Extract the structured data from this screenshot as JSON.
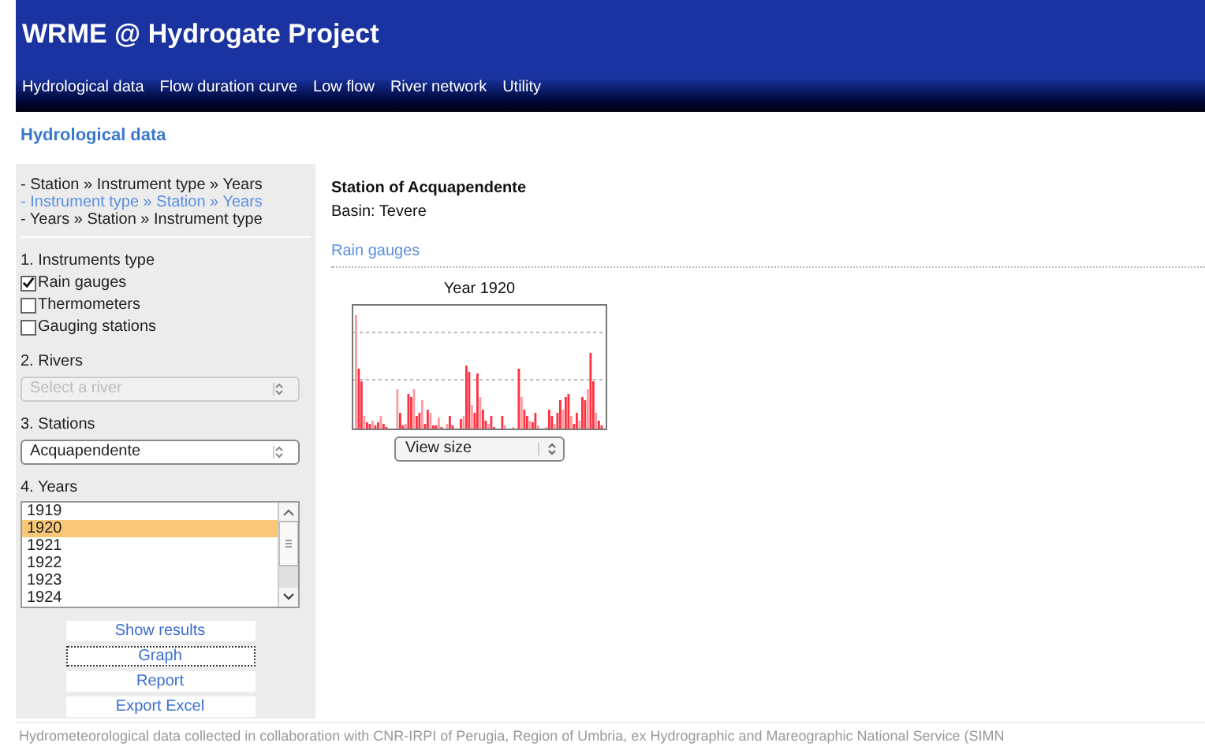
{
  "header": {
    "title": "WRME @ Hydrogate Project"
  },
  "nav": [
    {
      "label": "Hydrological data"
    },
    {
      "label": "Flow duration curve"
    },
    {
      "label": "Low flow"
    },
    {
      "label": "River network"
    },
    {
      "label": "Utility"
    }
  ],
  "page_title": "Hydrological data",
  "sidebar": {
    "paths": [
      {
        "label": "- Station » Instrument type » Years",
        "selected": false
      },
      {
        "label": "- Instrument type » Station » Years",
        "selected": true
      },
      {
        "label": "- Years » Station » Instrument type",
        "selected": false
      }
    ],
    "instruments_heading": "1. Instruments type",
    "instruments": [
      {
        "label": "Rain gauges",
        "checked": true
      },
      {
        "label": "Thermometers",
        "checked": false
      },
      {
        "label": "Gauging stations",
        "checked": false
      }
    ],
    "rivers_heading": "2. Rivers",
    "rivers_select": {
      "placeholder": "Select a river",
      "disabled": true
    },
    "stations_heading": "3. Stations",
    "stations_select": {
      "value": "Acquapendente",
      "disabled": false
    },
    "years_heading": "4. Years",
    "years": [
      {
        "label": "1919",
        "selected": false
      },
      {
        "label": "1920",
        "selected": true
      },
      {
        "label": "1921",
        "selected": false
      },
      {
        "label": "1922",
        "selected": false
      },
      {
        "label": "1923",
        "selected": false
      },
      {
        "label": "1924",
        "selected": false
      }
    ],
    "buttons": [
      {
        "label": "Show results",
        "focused": false
      },
      {
        "label": "Graph",
        "focused": true
      },
      {
        "label": "Report",
        "focused": false
      },
      {
        "label": "Export Excel",
        "focused": false
      }
    ]
  },
  "main": {
    "station": "Station of Acquapendente",
    "basin": "Basin: Tevere",
    "section": "Rain gauges",
    "graph_title": "Year 1920",
    "size_select": "View size"
  },
  "footer": "Hydrometeorological data collected in collaboration with CNR-IRPI of Perugia, Region of Umbria, ex Hydrographic and Mareographic National Service (SIMN"
}
